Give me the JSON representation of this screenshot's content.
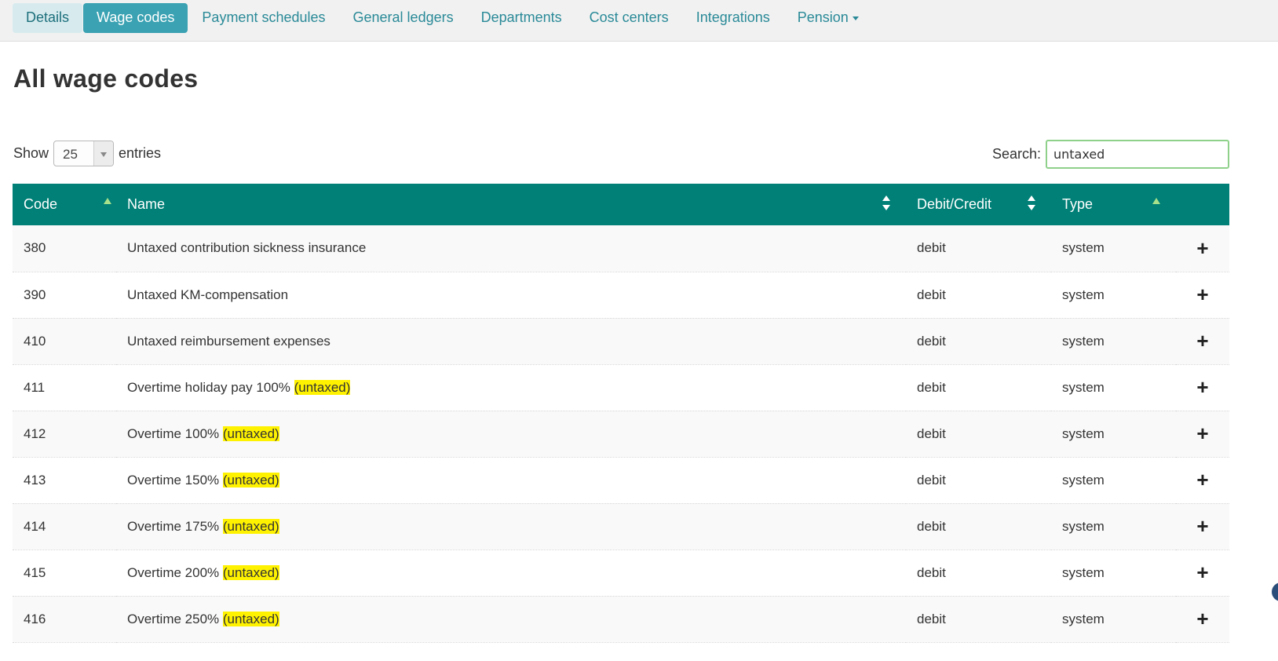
{
  "nav": {
    "tabs": [
      {
        "label": "Details"
      },
      {
        "label": "Wage codes"
      },
      {
        "label": "Payment schedules"
      },
      {
        "label": "General ledgers"
      },
      {
        "label": "Departments"
      },
      {
        "label": "Cost centers"
      },
      {
        "label": "Integrations"
      },
      {
        "label": "Pension"
      }
    ]
  },
  "page_title": "All wage codes",
  "length_control": {
    "show_label": "Show",
    "selected": "25",
    "entries_label": "entries"
  },
  "search": {
    "label": "Search:",
    "value": "untaxed"
  },
  "table": {
    "headers": {
      "code": "Code",
      "name": "Name",
      "debit_credit": "Debit/Credit",
      "type": "Type"
    },
    "rows": [
      {
        "code": "380",
        "name": "Untaxed contribution sickness insurance",
        "highlight": "",
        "debit_credit": "debit",
        "type": "system"
      },
      {
        "code": "390",
        "name": "Untaxed KM-compensation",
        "highlight": "",
        "debit_credit": "debit",
        "type": "system"
      },
      {
        "code": "410",
        "name": "Untaxed reimbursement expenses",
        "highlight": "",
        "debit_credit": "debit",
        "type": "system"
      },
      {
        "code": "411",
        "name": "Overtime holiday pay 100% ",
        "highlight": "(untaxed)",
        "debit_credit": "debit",
        "type": "system"
      },
      {
        "code": "412",
        "name": "Overtime 100% ",
        "highlight": "(untaxed)",
        "debit_credit": "debit",
        "type": "system"
      },
      {
        "code": "413",
        "name": "Overtime 150% ",
        "highlight": "(untaxed)",
        "debit_credit": "debit",
        "type": "system"
      },
      {
        "code": "414",
        "name": "Overtime 175% ",
        "highlight": "(untaxed)",
        "debit_credit": "debit",
        "type": "system"
      },
      {
        "code": "415",
        "name": "Overtime 200% ",
        "highlight": "(untaxed)",
        "debit_credit": "debit",
        "type": "system"
      },
      {
        "code": "416",
        "name": "Overtime 250% ",
        "highlight": "(untaxed)",
        "debit_credit": "debit",
        "type": "system"
      }
    ],
    "row_action_icon": "plus-icon"
  },
  "colors": {
    "header_bg": "#008077",
    "active_tab": "#3aa2b2",
    "highlight": "#fff200"
  }
}
